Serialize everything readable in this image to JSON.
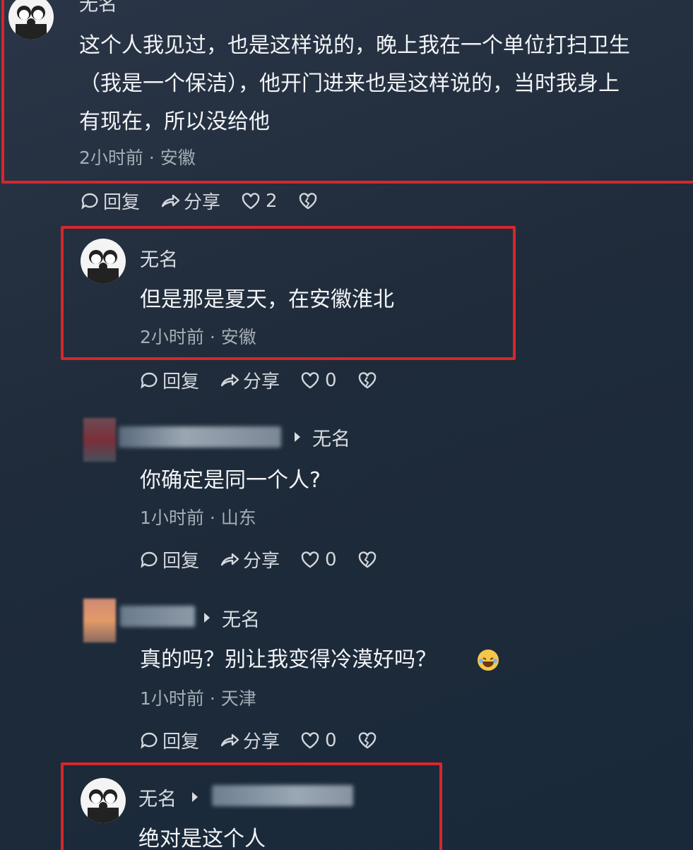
{
  "comments": [
    {
      "username": "无名",
      "text_lines": [
        "这个人我见过，也是这样说的，晚上我在一个单位打扫卫生",
        "（我是一个保洁），他开门进来也是这样说的，当时我身上",
        "有现在，所以没给他"
      ],
      "meta": "2小时前 · 安徽",
      "actions": {
        "reply": "回复",
        "share": "分享",
        "likes": "2"
      }
    },
    {
      "username": "无名",
      "text": "但是那是夏天，在安徽淮北",
      "meta": "2小时前 · 安徽",
      "actions": {
        "reply": "回复",
        "share": "分享",
        "likes": "0"
      }
    },
    {
      "reply_to": "无名",
      "text": "你确定是同一个人?",
      "meta": "1小时前 · 山东",
      "actions": {
        "reply": "回复",
        "share": "分享",
        "likes": "0"
      }
    },
    {
      "reply_to": "无名",
      "text": "真的吗？别让我变得冷漠好吗？",
      "emoji": "laughing-crying-emoji",
      "meta": "1小时前 · 天津",
      "actions": {
        "reply": "回复",
        "share": "分享",
        "likes": "0"
      }
    },
    {
      "username": "无名",
      "text": "绝对是这个人"
    }
  ],
  "colors": {
    "highlight": "#d8262b",
    "background": "#1f2b3a"
  }
}
